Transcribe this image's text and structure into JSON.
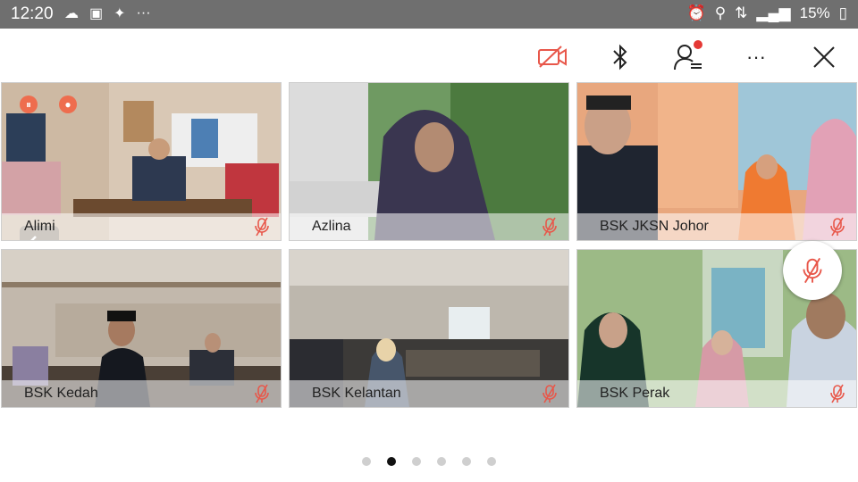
{
  "status_bar": {
    "time": "12:20",
    "battery": "15%"
  },
  "tiles": [
    {
      "name": "Alimi"
    },
    {
      "name": "Azlina"
    },
    {
      "name": "BSK JKSN Johor"
    },
    {
      "name": "BSK Kedah"
    },
    {
      "name": "BSK Kelantan"
    },
    {
      "name": "BSK Perak"
    }
  ],
  "pagination": {
    "pages": 6,
    "active": 2
  },
  "colors": {
    "accent": "#e8574a",
    "status_bar": "#6f6f6f",
    "dot_inactive": "#cfcfcf",
    "dot_active": "#111111"
  }
}
